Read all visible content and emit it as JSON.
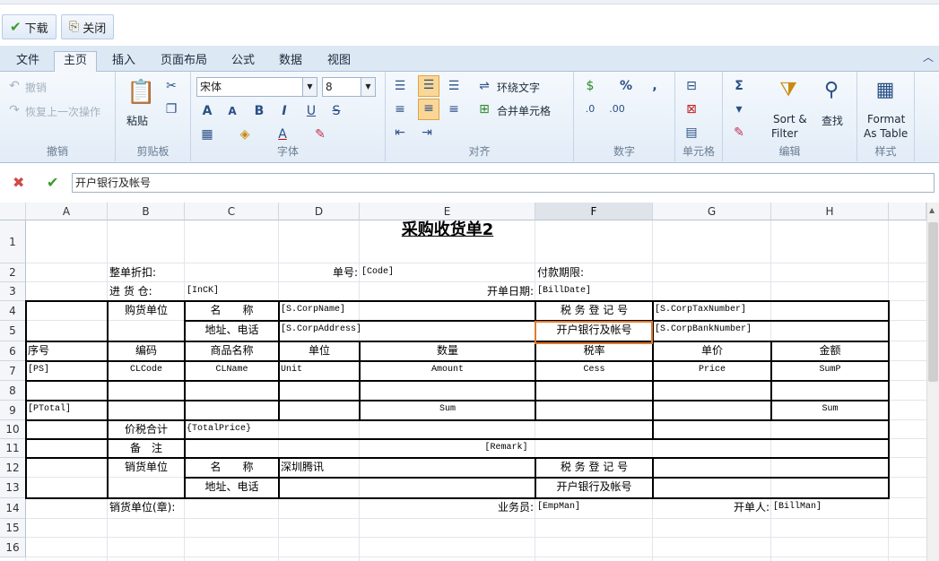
{
  "toolbar": {
    "download_label": "下载",
    "close_label": "关闭"
  },
  "tabs": [
    "文件",
    "主页",
    "插入",
    "页面布局",
    "公式",
    "数据",
    "视图"
  ],
  "ribbon": {
    "undo": {
      "undo": "撤销",
      "redo": "恢复上一次操作",
      "group": "撤销"
    },
    "clipboard": {
      "paste": "粘贴",
      "group": "剪贴板"
    },
    "font": {
      "name": "宋体",
      "size": "8",
      "group": "字体"
    },
    "align": {
      "wrap": "环绕文字",
      "merge": "合并单元格",
      "group": "对齐"
    },
    "number": {
      "group": "数字"
    },
    "cells": {
      "group": "单元格"
    },
    "edit": {
      "sort1": "Sort &",
      "sort2": "Filter",
      "find": "查找",
      "group": "编辑"
    },
    "style": {
      "fmt1": "Format",
      "fmt2": "As Table",
      "group": "样式"
    }
  },
  "formula": {
    "value": "开户银行及帐号"
  },
  "colors": {
    "accent": "#e07a2e",
    "ribbon": "#dde8f5",
    "grid": "#e1e5ea"
  },
  "columns": [
    "A",
    "B",
    "C",
    "D",
    "E",
    "F",
    "G",
    "H"
  ],
  "rows": [
    "1",
    "2",
    "3",
    "4",
    "5",
    "6",
    "7",
    "8",
    "9",
    "10",
    "11",
    "12",
    "13",
    "14",
    "15",
    "16"
  ],
  "cells": {
    "title": "采购收货单2",
    "r2_label": "整单折扣:",
    "r2_no": "单号:",
    "r2_code": "[Code]",
    "r2_term": "付款期限:",
    "r3_label": "进 货 仓:",
    "r3_inck": "[InCK]",
    "r3_date_label": "开单日期:",
    "r3_date": "[BillDate]",
    "buyer": "购货单位",
    "name": "名　　称",
    "corpname": "[S.CorpName]",
    "tax": "税 务 登 记 号",
    "corptax": "[S.CorpTaxNumber]",
    "addr": "地址、电话",
    "corpaddr": "[S.CorpAddress]",
    "bank": "开户银行及帐号",
    "corpbank": "[S.CorpBankNumber]",
    "h_seq": "序号",
    "h_code": "编码",
    "h_name": "商品名称",
    "h_unit": "单位",
    "h_qty": "数量",
    "h_tax": "税率",
    "h_price": "单价",
    "h_amt": "金额",
    "r7_ps": "[PS]",
    "r7_code": "CLCode",
    "r7_name": "CLName",
    "r7_unit": "Unit",
    "r7_amt": "Amount",
    "r7_cess": "Cess",
    "r7_price": "Price",
    "r7_sum": "SumP",
    "r9_total": "[PTotal]",
    "r9_sum1": "Sum",
    "r9_sum2": "Sum",
    "r10_label": "价税合计",
    "r10_val": "{TotalPrice}",
    "r11_label": "备　注",
    "r11_val": "[Remark]",
    "seller": "销货单位",
    "seller_name_label": "名　　称",
    "seller_name": "深圳腾讯",
    "seller_tax": "税 务 登 记 号",
    "seller_addr": "地址、电话",
    "seller_bank": "开户银行及帐号",
    "r14_seller": "销货单位(章):",
    "r14_emp_label": "业务员:",
    "r14_emp": "[EmpMan]",
    "r14_bill_label": "开单人:",
    "r14_bill": "[BillMan]"
  }
}
